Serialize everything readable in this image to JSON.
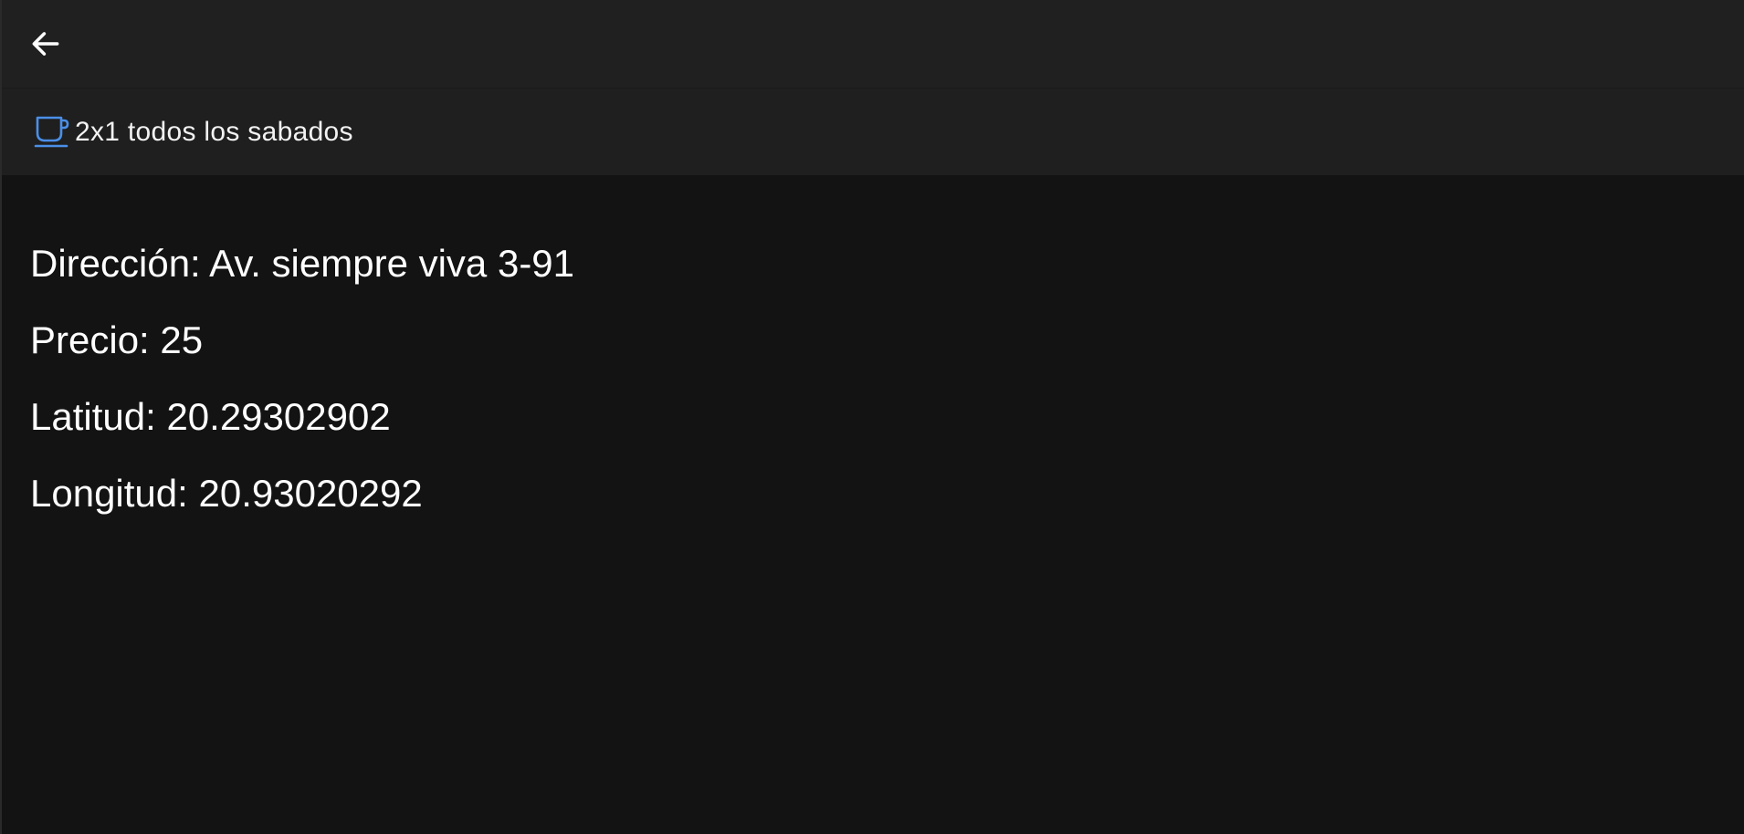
{
  "toolbar": {
    "back_icon": "arrow-left-icon"
  },
  "promo": {
    "icon": "coffee-cup-icon",
    "icon_color": "#4a8fe8",
    "text": "2x1 todos los sabados"
  },
  "details": {
    "direccion": "Dirección: Av. siempre viva 3-91",
    "precio": "Precio: 25",
    "latitud": "Latitud: 20.29302902",
    "longitud": "Longitud: 20.93020292"
  }
}
